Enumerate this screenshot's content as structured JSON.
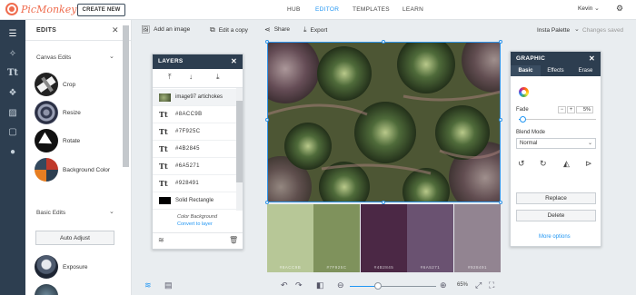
{
  "brand": {
    "name": "PicMonkey",
    "create_label": "CREATE NEW"
  },
  "nav": {
    "items": [
      "HUB",
      "EDITOR",
      "TEMPLATES",
      "LEARN"
    ],
    "active": "EDITOR"
  },
  "user": {
    "name": "Kevin"
  },
  "rail": {
    "icons": [
      "sliders-icon",
      "wand-icon",
      "text-icon",
      "shapes-icon",
      "texture-icon",
      "frame-icon",
      "apple-icon"
    ]
  },
  "edits": {
    "title": "EDITS",
    "sections": [
      {
        "label": "Canvas Edits",
        "items": [
          "Crop",
          "Resize",
          "Rotate",
          "Background Color"
        ]
      },
      {
        "label": "Basic Edits",
        "button": "Auto Adjust",
        "items": [
          "Exposure"
        ]
      }
    ]
  },
  "toolbar": {
    "add_image": "Add an image",
    "edit_copy": "Edit a copy",
    "share": "Share",
    "export": "Export",
    "palette": "Insta Palette",
    "saved": "Changes saved"
  },
  "layers": {
    "title": "LAYERS",
    "rows": [
      {
        "name": "image97 artichokes",
        "kind": "image"
      },
      {
        "name": "#8ACC9B",
        "kind": "text"
      },
      {
        "name": "#7F925C",
        "kind": "text"
      },
      {
        "name": "#4B2845",
        "kind": "text"
      },
      {
        "name": "#6A5271",
        "kind": "text"
      },
      {
        "name": "#928491",
        "kind": "text"
      },
      {
        "name": "Solid Rectangle",
        "kind": "rect"
      }
    ],
    "bg_label": "Color Background",
    "convert_label": "Convert to layer"
  },
  "swatches": [
    {
      "hex_label": "#8ACC9B",
      "color": "#b7c797"
    },
    {
      "hex_label": "#7F925C",
      "color": "#7f925c"
    },
    {
      "hex_label": "#4B2845",
      "color": "#4b2845"
    },
    {
      "hex_label": "#6A5271",
      "color": "#6a5271"
    },
    {
      "hex_label": "#928491",
      "color": "#928491"
    }
  ],
  "graphic": {
    "title": "GRAPHIC",
    "tabs": [
      "Basic",
      "Effects",
      "Erase"
    ],
    "active_tab": "Basic",
    "fade_label": "Fade",
    "fade_value": "5%",
    "fade_fraction": 0.05,
    "blend_label": "Blend Mode",
    "blend_value": "Normal",
    "replace_label": "Replace",
    "delete_label": "Delete",
    "more_label": "More options"
  },
  "zoom": {
    "label": "65%",
    "fraction": 0.33
  },
  "colors": {
    "accent": "#2196f3",
    "dark": "#2d3e50",
    "brand": "#ef6c4e"
  }
}
